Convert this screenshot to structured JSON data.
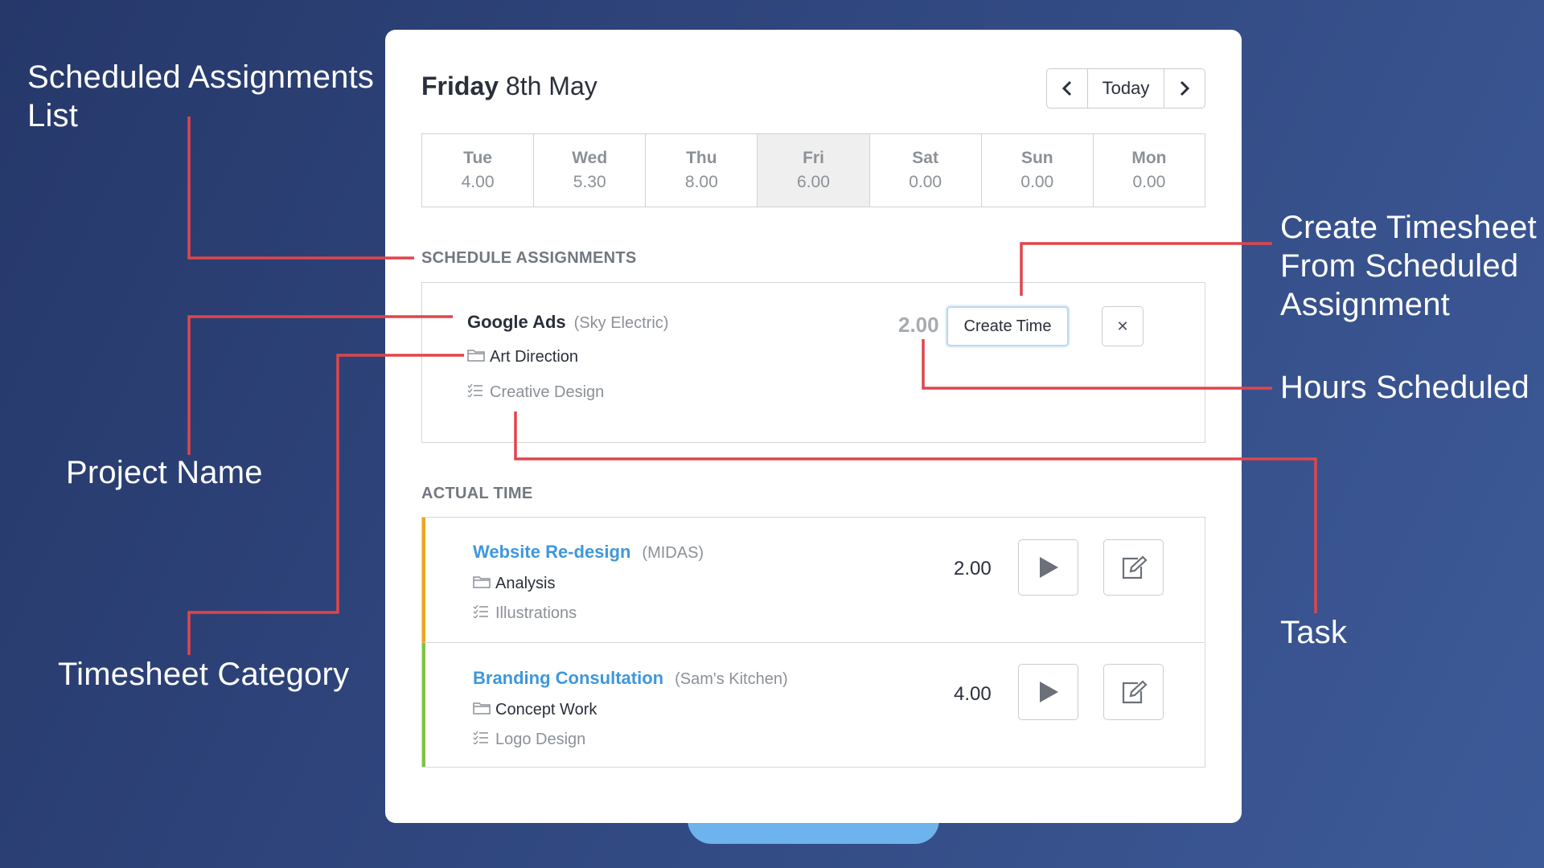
{
  "header": {
    "day_bold": "Friday",
    "date": "8th May",
    "today_label": "Today"
  },
  "days": [
    {
      "name": "Tue",
      "value": "4.00"
    },
    {
      "name": "Wed",
      "value": "5.30"
    },
    {
      "name": "Thu",
      "value": "8.00"
    },
    {
      "name": "Fri",
      "value": "6.00",
      "active": true
    },
    {
      "name": "Sat",
      "value": "0.00"
    },
    {
      "name": "Sun",
      "value": "0.00"
    },
    {
      "name": "Mon",
      "value": "0.00"
    }
  ],
  "schedule": {
    "title": "SCHEDULE ASSIGNMENTS",
    "project": "Google Ads",
    "client": "(Sky Electric)",
    "category": "Art Direction",
    "task": "Creative Design",
    "hours": "2.00",
    "create_label": "Create Time",
    "close_glyph": "✕"
  },
  "actual": {
    "title": "ACTUAL TIME",
    "entries": [
      {
        "project": "Website Re-design",
        "client": "(MIDAS)",
        "category": "Analysis",
        "task": "Illustrations",
        "hours": "2.00",
        "bar_color": "#f2a516"
      },
      {
        "project": "Branding Consultation",
        "client": "(Sam's Kitchen)",
        "category": "Concept Work",
        "task": "Logo Design",
        "hours": "4.00",
        "bar_color": "#7ec53e"
      }
    ]
  },
  "annotations": {
    "scheduled_list_line1": "Scheduled Assignments",
    "scheduled_list_line2": "List",
    "project_name": "Project Name",
    "timesheet_category": "Timesheet Category",
    "create_line1": "Create Timesheet",
    "create_line2": "From Scheduled",
    "create_line3": "Assignment",
    "hours_scheduled": "Hours Scheduled",
    "task": "Task"
  },
  "colors": {
    "accent_line": "#e0454b",
    "link_blue": "#3f97dc",
    "background": "#2f4579"
  }
}
